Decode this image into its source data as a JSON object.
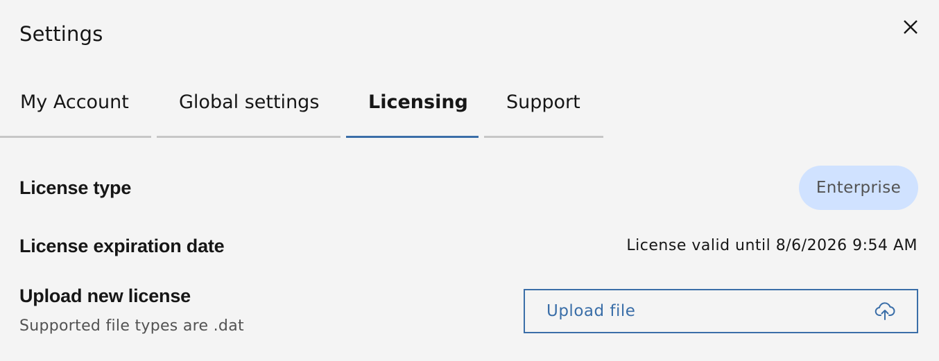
{
  "modal": {
    "title": "Settings",
    "close_icon": "close-icon"
  },
  "tabs": [
    {
      "label": "My Account",
      "active": false
    },
    {
      "label": "Global settings",
      "active": false
    },
    {
      "label": "Licensing",
      "active": true
    },
    {
      "label": "Support",
      "active": false
    }
  ],
  "licensing": {
    "license_type_label": "License type",
    "license_type_value": "Enterprise",
    "expiration_label": "License expiration date",
    "expiration_value": "License valid until 8/6/2026 9:54 AM",
    "upload_label": "Upload new license",
    "upload_help": "Supported file types are .dat",
    "upload_button_label": "Upload file",
    "upload_icon": "cloud-upload-icon"
  },
  "colors": {
    "background": "#f4f4f4",
    "accent": "#3a6ea8",
    "pill_background": "#d0e2ff",
    "inactive_tab_border": "#c6c6c6"
  }
}
